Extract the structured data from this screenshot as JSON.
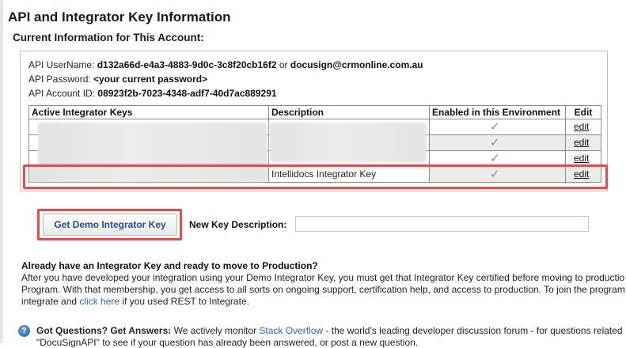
{
  "page": {
    "title": "API and Integrator Key Information",
    "section_title": "Current Information for This Account:"
  },
  "account": {
    "username_label": "API UserName:",
    "username_value": "d132a66d-e4a3-4883-9d0c-3c8f20cb16f2",
    "username_or": "or",
    "username_email": "docusign@crmonline.com.au",
    "password_label": "API Password:",
    "password_value": "<your current password>",
    "account_id_label": "API Account ID:",
    "account_id_value": "08923f2b-7023-4348-adf7-40d7ac889291"
  },
  "keys_table": {
    "headers": [
      "Active Integrator Keys",
      "Description",
      "Enabled in this Environment",
      "Edit"
    ],
    "rows": [
      {
        "key": "",
        "description": "",
        "enabled": "✓",
        "edit": "edit"
      },
      {
        "key": "",
        "description": "",
        "enabled": "✓",
        "edit": "edit"
      },
      {
        "key": "",
        "description": "",
        "enabled": "✓",
        "edit": "edit"
      },
      {
        "key": "",
        "description": "Intellidocs Integrator Key",
        "enabled": "✓",
        "edit": "edit"
      }
    ]
  },
  "new_key": {
    "button_label": "Get Demo Integrator Key",
    "description_label": "New Key Description:",
    "description_value": ""
  },
  "production": {
    "title": "Already have an Integrator Key and ready to move to Production?",
    "line1": "After you have developed your integration using your Demo Integrator Key, you must get that Integrator Key certified before moving to productio",
    "line2": "Program. With that membership, you get access to all sorts on ongoing support, certification help, and access to production. To join the program",
    "line3_pre": "integrate and ",
    "line3_link": "click here",
    "line3_post": " if you used REST to Integrate."
  },
  "questions": {
    "title": "Got Questions? Get Answers:",
    "text_pre": " We actively monitor ",
    "link": "Stack Overflow",
    "text_post": " - the world's leading developer discussion forum - for questions related",
    "line2": "\"DocuSignAPI\" to see if your question has already been answered, or post a new question."
  },
  "colors": {
    "highlight": "#d9534f",
    "check": "#6aa84f",
    "link": "#2a6ab8",
    "button_text": "#1f4e8c"
  }
}
